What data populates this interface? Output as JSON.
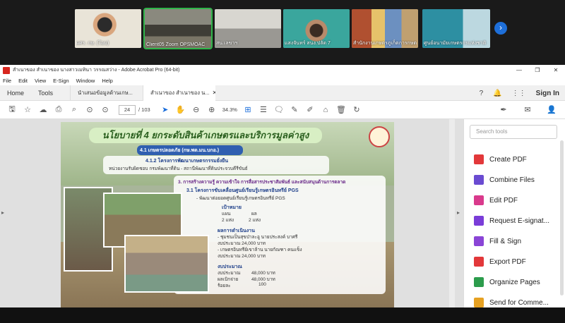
{
  "zoom": {
    "participants": [
      {
        "name": "ผศร. กษ. (โอม)",
        "bg": "#e9e4d8"
      },
      {
        "name": "Client05 Zoom OPSMOAC",
        "bg": "#6b6a60"
      },
      {
        "name": "สน.เลขาฯ",
        "bg": "#c9c7c2"
      },
      {
        "name": "แสงจันทร์ สนง.ปลัด 7",
        "bg": "#3aa69d"
      },
      {
        "name": "สำนักงานเกษตรภูเก็ตการกษตร",
        "bg": "#9c8a7a"
      },
      {
        "name": "ศูนย์อนามัยเกษตรกรแห่งชาติ",
        "bg": "#2d8fa2"
      }
    ],
    "next_icon": "chevron-right-icon"
  },
  "acrobat": {
    "window_title": "สำเนาของ สำเนาของ นางสาวเมทินา วรรณสว่าง - Adobe Acrobat Pro (64-bit)",
    "menu": [
      "File",
      "Edit",
      "View",
      "E-Sign",
      "Window",
      "Help"
    ],
    "tabs": {
      "home": "Home",
      "tools": "Tools",
      "doc1": "นำเสนอข้อมูลด้านเกษ...",
      "doc2": "สำเนาของ สำเนาของ น..."
    },
    "sign_in": "Sign In",
    "toolbar": {
      "page_current": "24",
      "page_total": "/ 103",
      "zoom": "34.3%"
    },
    "slide": {
      "title": "นโยบายที่ 4 ยกระดับสินค้าเกษตรและบริการมูลค่าสูง",
      "items": [
        "4.1 เกษตรปลอดภัย (กษ.พด.มน.บกอ.)",
        "4.1.2 โครงการพัฒนาเกษตรกรรมยั่งยืน",
        "หน่วยงานรับผิดชอบ กรมพัฒนาที่ดิน - สถานีพัฒนาที่ดินประจวบคีรีขันธ์",
        "3. การสร้างความรู้ ความเข้าใจ การสื่อสารประชาสัมพันธ์ และสนับสนุนด้านการตลาด",
        "3.1 โครงการขับเคลื่อนศูนย์เรียนรู้เกษตรอินทรีย์ PGS",
        "- พัฒนาต่อยอดศูนย์เรียนรู้เกษตรอินทรีย์ PGS"
      ],
      "target_heading": "เป้าหมาย",
      "target_plan_label": "แผน",
      "target_result_label": "ผล",
      "target_plan": "2 แห่ง",
      "target_result": "2 แห่ง",
      "results_heading": "ผลการดำเนินงาน",
      "results": [
        "- ชุมชนเป็นสุขป่าละอู นายประสงค์ บาศรี",
        "  งบประมาณ 24,000 บาท",
        "- เกษตรอินทรีย์เขาล้าน นายกัณฑา คนแข็ง",
        "  งบประมาณ 24,000 บาท"
      ],
      "budget_heading": "งบประมาณ",
      "budget_rows": [
        {
          "label": "งบประมาณ",
          "value": "48,000 บาท"
        },
        {
          "label": "ผลเบิกจ่าย",
          "value": "48,000 บาท"
        },
        {
          "label": "ร้อยละ",
          "value": "100"
        }
      ]
    },
    "tools_panel": {
      "search_placeholder": "Search tools",
      "items": [
        {
          "label": "Create PDF",
          "color": "#e2383a",
          "icon": "create-pdf-icon"
        },
        {
          "label": "Combine Files",
          "color": "#6a4bd1",
          "icon": "combine-files-icon"
        },
        {
          "label": "Edit PDF",
          "color": "#d93a8c",
          "icon": "edit-pdf-icon"
        },
        {
          "label": "Request E-signat...",
          "color": "#7a3dd8",
          "icon": "request-esign-icon"
        },
        {
          "label": "Fill & Sign",
          "color": "#8a45d6",
          "icon": "fill-sign-icon"
        },
        {
          "label": "Export PDF",
          "color": "#e2383a",
          "icon": "export-pdf-icon"
        },
        {
          "label": "Organize Pages",
          "color": "#2c9c4c",
          "icon": "organize-pages-icon"
        },
        {
          "label": "Send for Comme...",
          "color": "#e6a122",
          "icon": "send-comment-icon"
        }
      ]
    }
  }
}
